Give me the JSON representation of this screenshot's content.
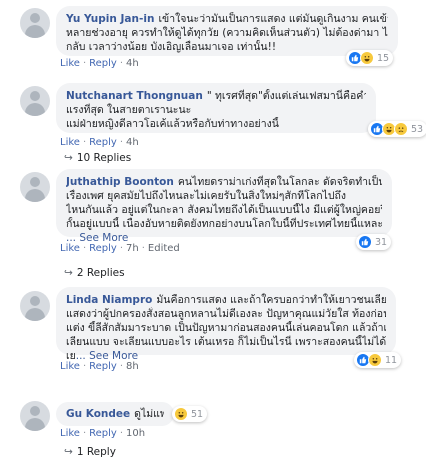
{
  "ui": {
    "separator": "·",
    "reply_arrow": "↪",
    "colors": {
      "link": "#385898",
      "like_blue": "#1877f2",
      "bubble_bg": "#f2f3f5"
    }
  },
  "comments": [
    {
      "author": "Yu Yupin Jan-in",
      "lines": [
        "เข้าใจนะว่ามันเป็นการแสดง แต่มันดูเกินงาม คนเข้าไปมี",
        "หลายช่วงอายุ ควรทำให้ดูได้ทุกวัย (ความคิดเห็นส่วนตัว) ไม่ต้องด่ามา ไม่ดา",
        "กลับ เวลาว่างน้อย บังเอิญเลื่อนมาเจอ เท่านั้น!!"
      ],
      "actions": {
        "like": "Like",
        "reply": "Reply",
        "time": "4h"
      },
      "reactions": {
        "icons": [
          "like-icon",
          "haha-icon"
        ],
        "count": "15"
      }
    },
    {
      "author": "Nutchanart Thongnuan",
      "lines": [
        "\" ทุเรศที่สุด\"ตั้งแต่เล่นเฟสมานี่คือคำพูดเราที่",
        "แรงที่สุด ในสายตาเรานะนะ",
        "แม่ฝ่ายหญิงดีลาวโอเค้แล้วหรือกับท่าทางอย่างนี้"
      ],
      "actions": {
        "like": "Like",
        "reply": "Reply",
        "time": "4h"
      },
      "reactions": {
        "icons": [
          "like-icon",
          "haha-icon",
          "sad-icon"
        ],
        "count": "53"
      },
      "replies": "10 Replies"
    },
    {
      "author": "Juthathip Boonton",
      "lines": [
        "คนไทยดราม่าเก่งที่สุดในโลกละ ดัดจริตทำเป็นปิดกัน",
        "เรื่องเพศ ยุคสมัยไปถึงไหนละไม่เคยรับในสิ่งใหม่ๆสักทีโลกไปถึง",
        "ไหนกันแล้ว อยู่แต่ในกะลา สังคมไทยถึงได้เป็นแบบนี้ไง มีแต่ผู้ใหญ่คอยปิด",
        "กั้นอยู่แบบนี้ เนื่องอับหายติดยังทกอย่างบนโลกใบนี้ที่ประเทศไทยนี้แหละ"
      ],
      "see_more": "... See More",
      "actions": {
        "like": "Like",
        "reply": "Reply",
        "time": "7h",
        "edited": "Edited"
      },
      "reactions": {
        "icons": [
          "like-icon"
        ],
        "count": "31"
      },
      "replies": "2 Replies"
    },
    {
      "author": "Linda Niampro",
      "lines": [
        "มันคือการแสดง และถ้าใครบอกว่าทำให้เยาวชนเลียนแบบ",
        "แสดงว่าผู้ปกครองสั่งสอนลูกหลานไม่ดีเองละ ปัญหาคุณแม่วัยใส ท้องก่อน",
        "แต่ง ขี้ลีสักสัมมาระบาด เป็นปัญหามาก่อนสองคนนี้เล่นคอนโดก แล้วถ้าเด็ก",
        "เลียนแบบ จะเลียนแบบอะไร เต้นเหรอ ก็ไม่เป็นไรนี่ เพราะสองคนนี้ไม่ได้",
        "เย"
      ],
      "see_more": "... See More",
      "actions": {
        "like": "Like",
        "reply": "Reply",
        "time": "8h"
      },
      "reactions": {
        "icons": [
          "like-icon",
          "haha-icon"
        ],
        "count": "11"
      }
    },
    {
      "author": "Gu Kondee",
      "lines": [
        "ดูไม่แพง"
      ],
      "actions": {
        "like": "Like",
        "reply": "Reply",
        "time": "10h"
      },
      "reactions": {
        "icons": [
          "haha-icon"
        ],
        "count": "51"
      },
      "replies": "1 Reply"
    }
  ]
}
